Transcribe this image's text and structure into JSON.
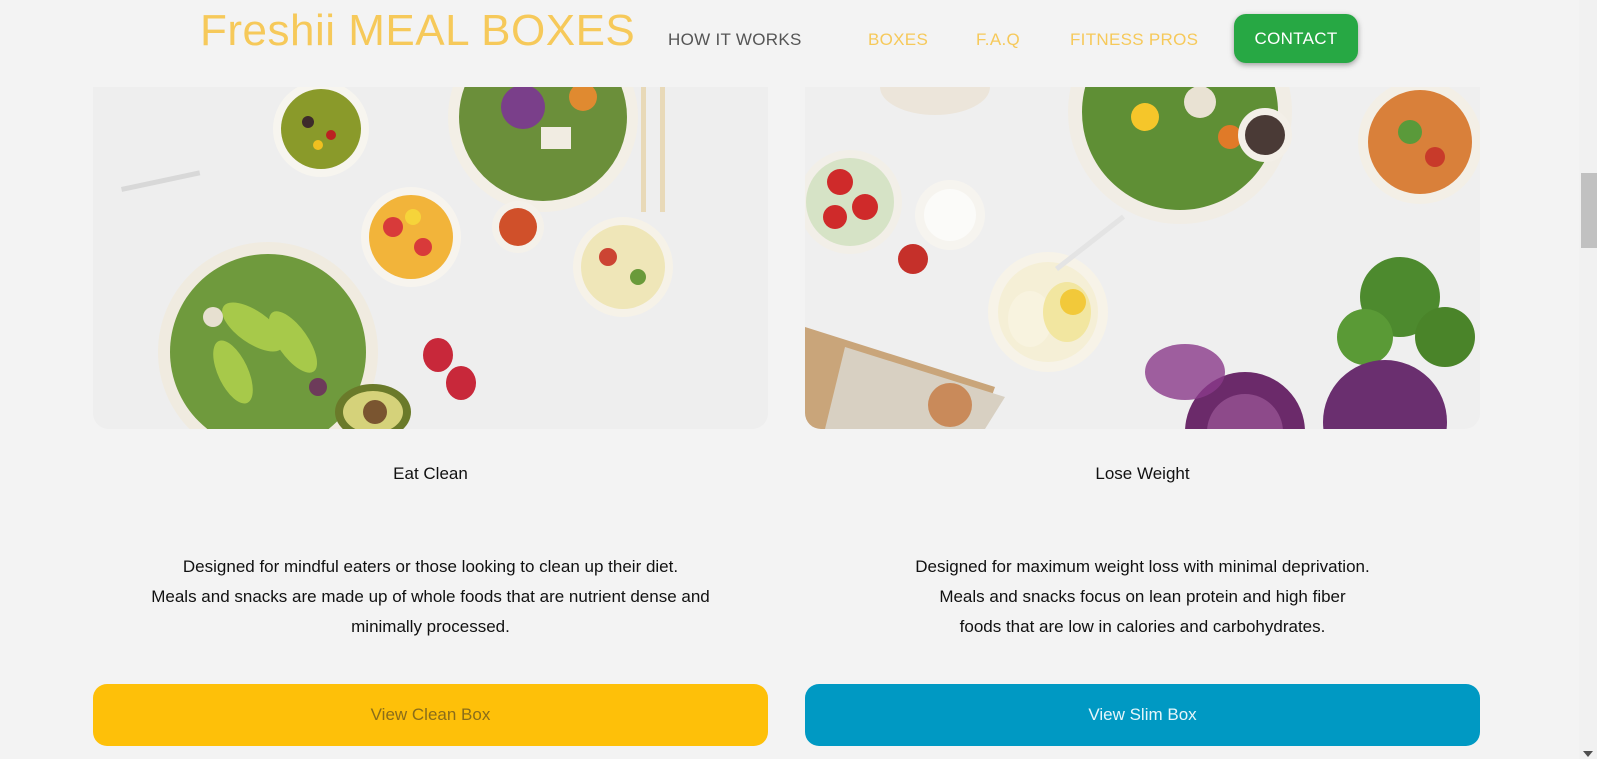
{
  "header": {
    "logo": "Freshii MEAL BOXES",
    "nav": {
      "how_it_works": "HOW IT WORKS",
      "boxes": "BOXES",
      "faq": "F.A.Q",
      "fitness_pros": "FITNESS PROS"
    },
    "contact": "CONTACT"
  },
  "cards": [
    {
      "title": "Eat Clean",
      "description": [
        "Designed for mindful eaters or those looking to clean up their diet.",
        "Meals and snacks are made up of whole foods that are nutrient dense and",
        "minimally processed."
      ],
      "button": "View Clean Box"
    },
    {
      "title": "Lose Weight",
      "description": [
        "Designed for maximum weight loss with minimal deprivation.",
        "Meals and snacks focus on lean protein and high fiber",
        "foods that are low in calories and carbohydrates."
      ],
      "button": "View Slim Box"
    }
  ],
  "colors": {
    "brand_yellow": "#f6c95a",
    "contact_green": "#27a844",
    "clean_button": "#fec009",
    "slim_button": "#0099c3"
  }
}
